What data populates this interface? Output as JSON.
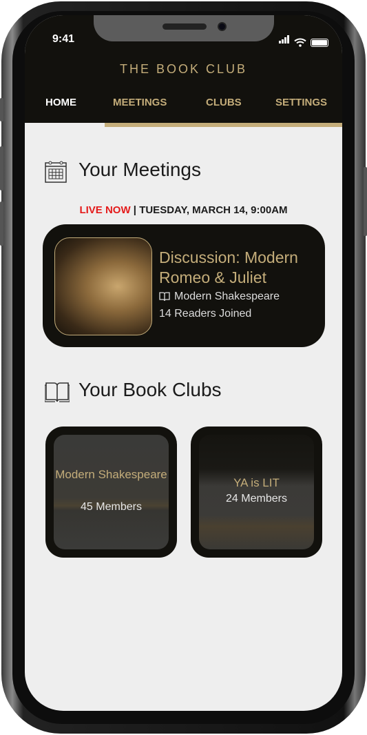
{
  "status_bar": {
    "time": "9:41"
  },
  "app": {
    "title": "THE BOOK CLUB"
  },
  "nav": {
    "tabs": [
      {
        "label": "HOME"
      },
      {
        "label": "MEETINGS"
      },
      {
        "label": "CLUBS"
      },
      {
        "label": "SETTINGS"
      }
    ],
    "active": "HOME"
  },
  "meetings": {
    "heading": "Your Meetings",
    "live_label": "LIVE NOW",
    "separator": " | ",
    "datetime": "TUESDAY, MARCH 14, 9:00AM",
    "card": {
      "title": "Discussion: Modern Romeo & Juliet",
      "club": "Modern Shakespeare",
      "readers": "14 Readers Joined"
    }
  },
  "clubs": {
    "heading": "Your Book Clubs",
    "items": [
      {
        "name": "Modern Shakespeare",
        "members": "45 Members"
      },
      {
        "name": "YA is LIT",
        "members": "24 Members"
      }
    ]
  },
  "colors": {
    "accent": "#c4ad7a",
    "dark": "#12110d",
    "live": "#e41b1b",
    "background": "#eeeeee"
  }
}
